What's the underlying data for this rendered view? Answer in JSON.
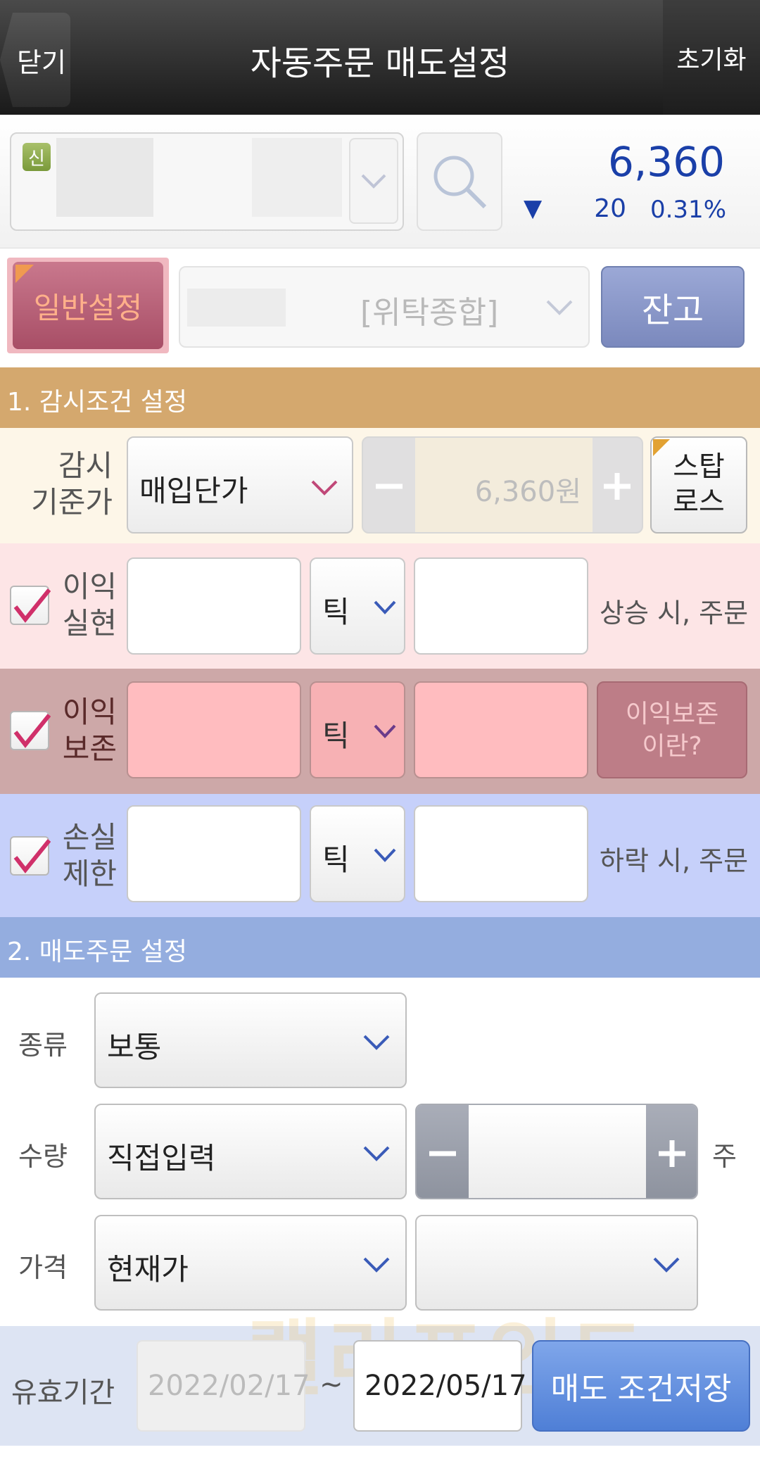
{
  "header": {
    "back_label": "닫기",
    "title": "자동주문 매도설정",
    "reset_label": "초기화"
  },
  "stock": {
    "badge": "신",
    "price": "6,360",
    "change_arrow": "▼",
    "change_value": "20",
    "change_percent": "0.31%"
  },
  "settings_row": {
    "general_setting_label": "일반설정",
    "account_type": "[위탁종합]",
    "balance_label": "잔고"
  },
  "section1": {
    "title": "1. 감시조건 설정",
    "monitor_label_1": "감시",
    "monitor_label_2": "기준가",
    "monitor_basis": "매입단가",
    "monitor_price": "6,360원",
    "stoploss_line1": "스탑",
    "stoploss_line2": "로스",
    "take_profit": {
      "label_1": "이익",
      "label_2": "실현",
      "unit": "틱",
      "suffix": "상승 시, 주문",
      "checked": true
    },
    "profit_preserve": {
      "label_1": "이익",
      "label_2": "보존",
      "unit": "틱",
      "help_line1": "이익보존",
      "help_line2": "이란?",
      "checked": true
    },
    "stop_loss": {
      "label_1": "손실",
      "label_2": "제한",
      "unit": "틱",
      "suffix": "하락 시, 주문",
      "checked": true
    }
  },
  "section2": {
    "title": "2. 매도주문 설정",
    "type_label": "종류",
    "type_value": "보통",
    "qty_label": "수량",
    "qty_mode": "직접입력",
    "qty_unit": "주",
    "price_label": "가격",
    "price_mode": "현재가"
  },
  "bottom": {
    "validity_label": "유효기간",
    "date_from": "2022/02/17",
    "tilde": "~",
    "date_to": "2022/05/17",
    "save_label": "매도 조건저장",
    "watermark": "랠리포인트"
  },
  "colors": {
    "header_bg": "#2a2a2a",
    "price_blue": "#1a3fa8",
    "section1_bg": "#d4a86e",
    "section2_bg": "#94addf",
    "check_mark": "#d0306a",
    "chevron_blue": "#3a5bb8",
    "chevron_pink": "#c04878"
  }
}
